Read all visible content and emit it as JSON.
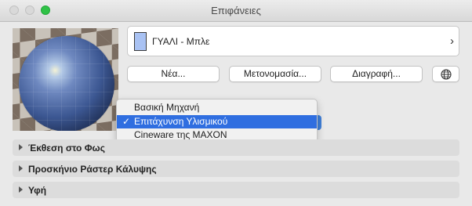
{
  "window": {
    "title": "Επιφάνειες"
  },
  "surface": {
    "name": "ΓΥΑΛΙ - Μπλε",
    "swatch_color": "#a9c2f3"
  },
  "buttons": {
    "new": "Νέα...",
    "rename": "Μετονομασία...",
    "delete": "Διαγραφή..."
  },
  "engine_menu": {
    "items": [
      {
        "label": "Βασική Μηχανή",
        "selected": false
      },
      {
        "label": "Επιτάχυνση Υλισμικού",
        "selected": true
      },
      {
        "label": "Cineware της MAXON",
        "selected": false
      }
    ],
    "check_glyph": "✓"
  },
  "sections": [
    {
      "label": "Έκθεση στο Φως"
    },
    {
      "label": "Προσκήνιο Ράστερ Κάλυψης"
    },
    {
      "label": "Υφή"
    }
  ],
  "icons": {
    "surface_chevron": "›",
    "engine_select_arrow": "›",
    "globe": "globe-icon"
  },
  "colors": {
    "accent": "#2f6ee0",
    "zoom_button": "#2fc246"
  }
}
